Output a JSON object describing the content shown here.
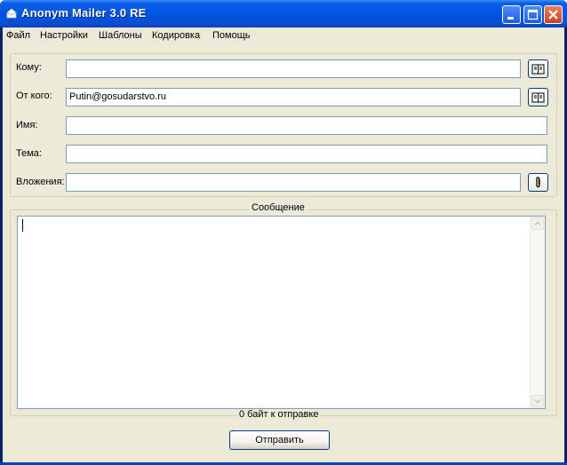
{
  "window": {
    "title": "Anonym Mailer 3.0 RE"
  },
  "menu": [
    "Файл",
    "Настройки",
    "Шаблоны",
    "Кодировка",
    "Помощь"
  ],
  "form": {
    "to_label": "Кому:",
    "to_value": "",
    "from_label": "От кого:",
    "from_value": "Putin@gosudarstvo.ru",
    "name_label": "Имя:",
    "name_value": "",
    "subject_label": "Тема:",
    "subject_value": "",
    "attachments_label": "Вложения:",
    "attachments_value": ""
  },
  "message": {
    "caption": "Сообщение",
    "body": "",
    "status": "0 байт к отправке"
  },
  "actions": {
    "send_label": "Отправить"
  },
  "icons": {
    "to_book": "address-book-icon",
    "from_book": "address-book-icon",
    "attach": "paperclip-icon"
  },
  "colors": {
    "titlebar": "#0054e3",
    "window_bg": "#ece9d8",
    "field_border": "#7f9db9",
    "close_button": "#c9421c"
  }
}
